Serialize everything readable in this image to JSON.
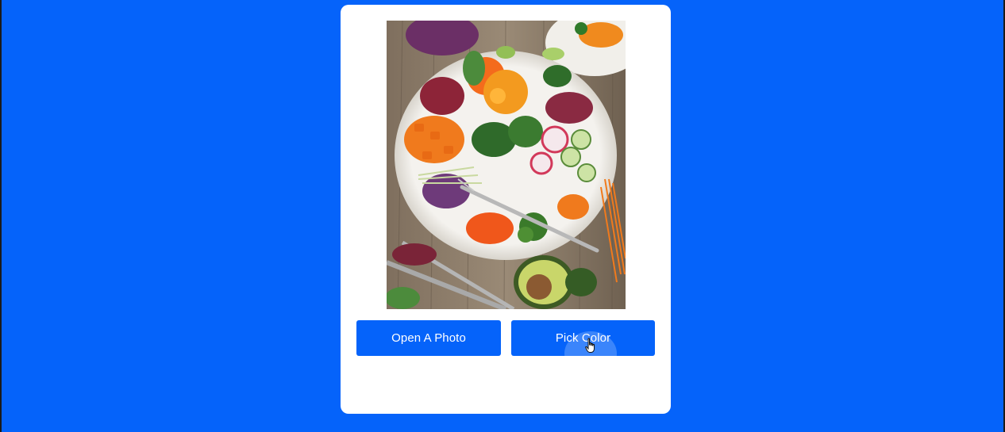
{
  "app": {
    "background_color": "#0563FA",
    "card_color": "#FFFFFF"
  },
  "photo": {
    "subject": "salad bowl with vegetables on wooden table"
  },
  "buttons": {
    "open_photo_label": "Open A Photo",
    "pick_color_label": "Pick Color",
    "color": "#0563FA"
  },
  "cursor": {
    "icon": "hand-pointer-icon"
  }
}
